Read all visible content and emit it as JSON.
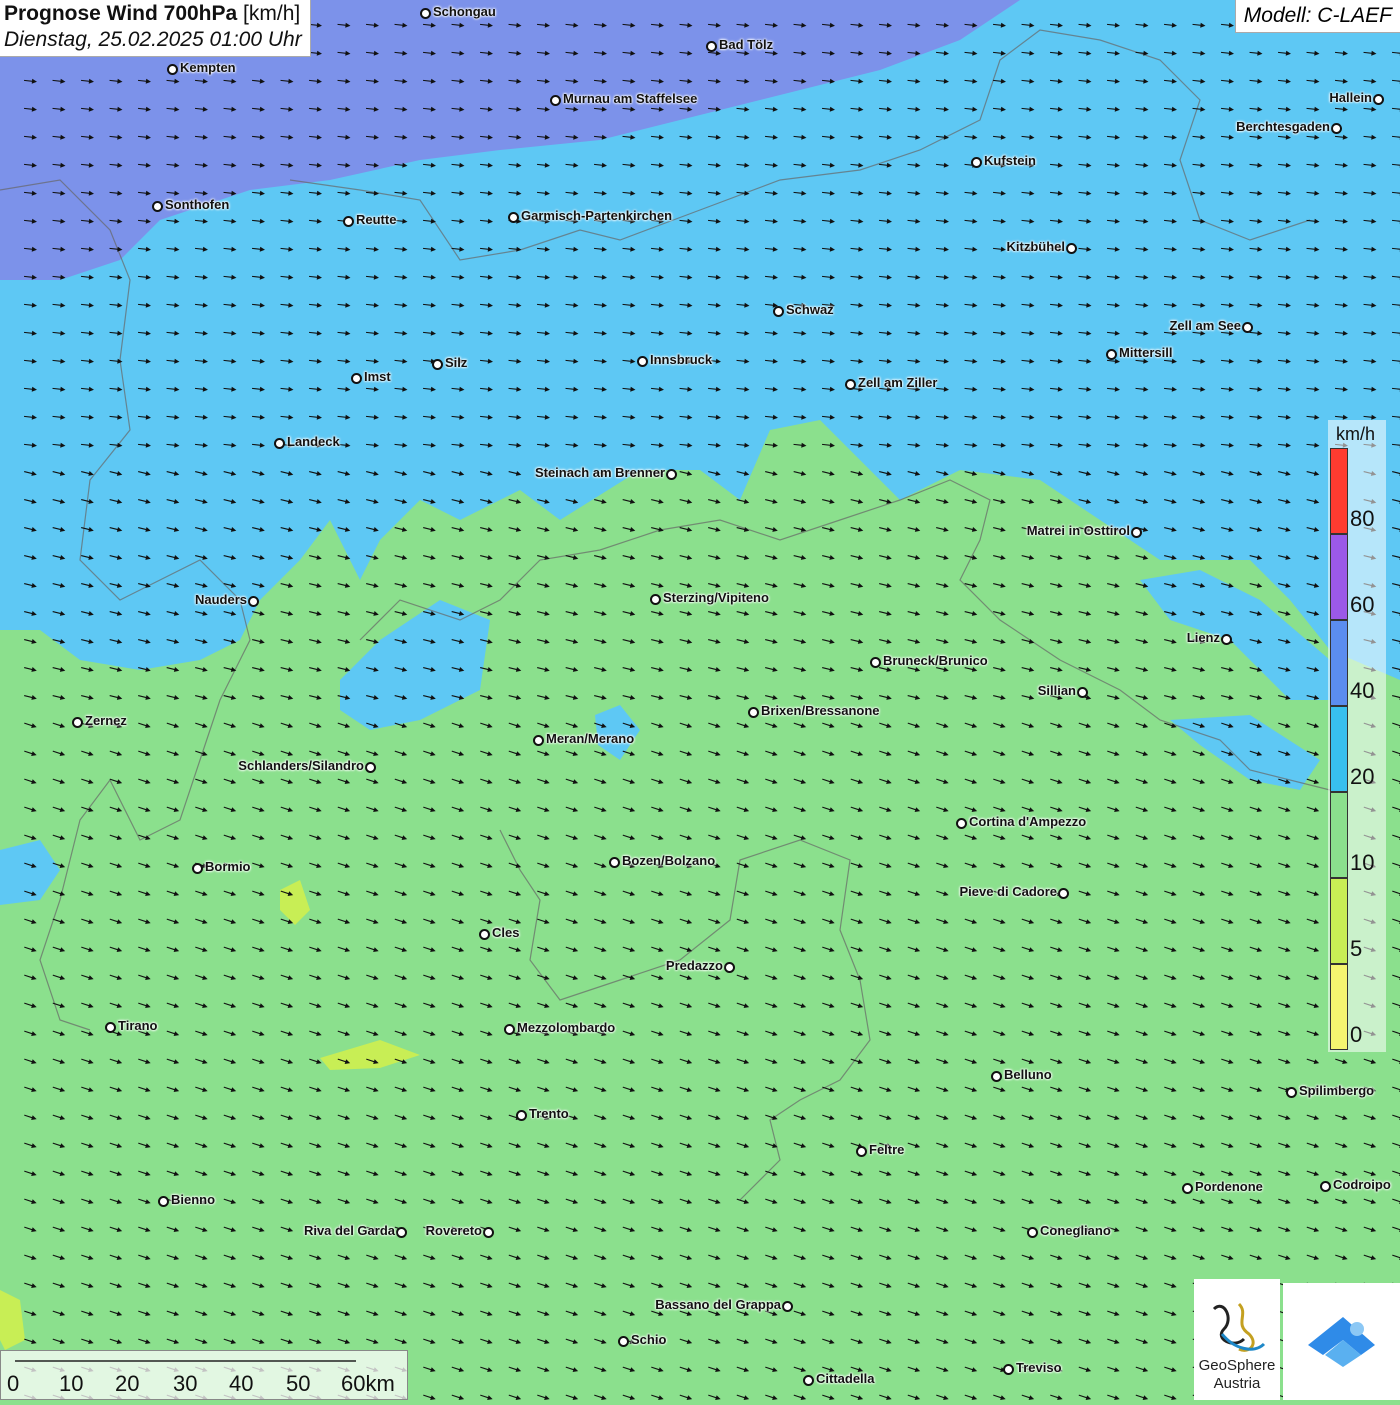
{
  "title": {
    "main_bold": "Prognose Wind 700hPa",
    "unit": "[km/h]",
    "date": "Dienstag, 25.02.2025 01:00 Uhr"
  },
  "model": "Modell: C-LAEF",
  "legend": {
    "unit": "km/h",
    "ticks": [
      "80",
      "60",
      "40",
      "20",
      "10",
      "5",
      "0"
    ],
    "colors": [
      "#ff3b30",
      "#9b59e8",
      "#5b8def",
      "#38c0ee",
      "#8be08d",
      "#c8ee55",
      "#f5f570"
    ]
  },
  "scale_bar": {
    "labels": [
      "0",
      "10",
      "20",
      "30",
      "40",
      "50",
      "60km"
    ]
  },
  "logos": {
    "geosphere_line1": "GeoSphere",
    "geosphere_line2": "Austria"
  },
  "colors": {
    "zone_40_60": "#7c92ea",
    "zone_20_40": "#5ec8f4",
    "zone_10_20": "#8be08d",
    "zone_5_10": "#c8ee55",
    "zone_0_5": "#f5f570",
    "arrow": "#111111"
  },
  "cities": [
    {
      "name": "Schongau"
    },
    {
      "name": "Bad Tölz"
    },
    {
      "name": "Kempten"
    },
    {
      "name": "Murnau am Staffelsee"
    },
    {
      "name": "Hallein"
    },
    {
      "name": "Berchtesgaden"
    },
    {
      "name": "Kufstein"
    },
    {
      "name": "Sonthofen"
    },
    {
      "name": "Reutte"
    },
    {
      "name": "Garmisch-Partenkirchen"
    },
    {
      "name": "Kitzbühel"
    },
    {
      "name": "Schwaz"
    },
    {
      "name": "Zell am See"
    },
    {
      "name": "Innsbruck"
    },
    {
      "name": "Silz"
    },
    {
      "name": "Mittersill"
    },
    {
      "name": "Imst"
    },
    {
      "name": "Zell am Ziller"
    },
    {
      "name": "Landeck"
    },
    {
      "name": "Steinach am Brenner"
    },
    {
      "name": "Matrei in Osttirol"
    },
    {
      "name": "Nauders"
    },
    {
      "name": "Sterzing/Vipiteno"
    },
    {
      "name": "Lienz"
    },
    {
      "name": "Bruneck/Brunico"
    },
    {
      "name": "Sillian"
    },
    {
      "name": "Brixen/Bressanone"
    },
    {
      "name": "Zernez"
    },
    {
      "name": "Meran/Merano"
    },
    {
      "name": "Schlanders/Silandro"
    },
    {
      "name": "Cortina d'Ampezzo"
    },
    {
      "name": "Bozen/Bolzano"
    },
    {
      "name": "Bormio"
    },
    {
      "name": "Pieve di Cadore"
    },
    {
      "name": "Cles"
    },
    {
      "name": "Predazzo"
    },
    {
      "name": "Tirano"
    },
    {
      "name": "Mezzolombardo"
    },
    {
      "name": "Belluno"
    },
    {
      "name": "Spilimbergo"
    },
    {
      "name": "Trento"
    },
    {
      "name": "Feltre"
    },
    {
      "name": "Pordenone"
    },
    {
      "name": "Codroipo"
    },
    {
      "name": "Bienno"
    },
    {
      "name": "Riva del Garda"
    },
    {
      "name": "Rovereto"
    },
    {
      "name": "Conegliano"
    },
    {
      "name": "Bassano del Grappa"
    },
    {
      "name": "Schio"
    },
    {
      "name": "Treviso"
    },
    {
      "name": "Cittadella"
    }
  ]
}
